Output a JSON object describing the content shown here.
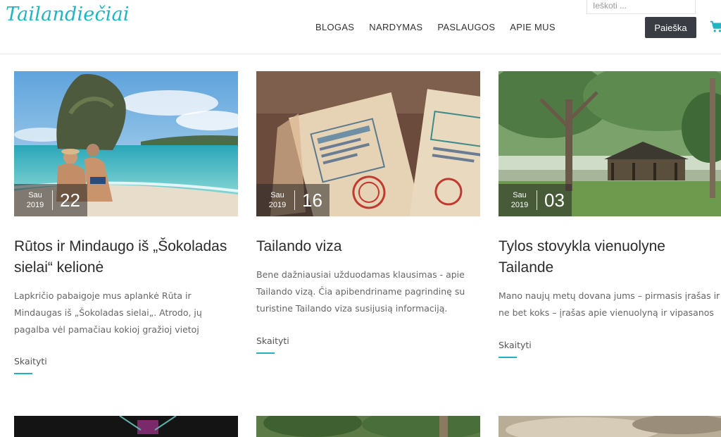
{
  "site": {
    "logo": "Tailandiečiai"
  },
  "nav": {
    "items": [
      "BLOGAS",
      "NARDYMAS",
      "PASLAUGOS",
      "APIE MUS"
    ]
  },
  "search": {
    "placeholder": "Ieškoti ...",
    "button_label": "Paieška"
  },
  "colors": {
    "accent": "#22b3c3",
    "search_button": "#3a3c44"
  },
  "posts": [
    {
      "month": "Sau",
      "year": "2019",
      "day": "22",
      "title": "Rūtos ir Mindaugo iš „Šokoladas sielai“ kelionė",
      "excerpt": "Lapkričio pabaigoje mus aplankė Rūta ir Mindaugas iš „Šokoladas sielai„. Atrodo, jų pagalba vėl pamačiau kokioj gražioj vietoj",
      "read_more": "Skaityti"
    },
    {
      "month": "Sau",
      "year": "2019",
      "day": "16",
      "title": "Tailando viza",
      "excerpt": "Bene dažniausiai užduodamas klausimas - apie Tailando vizą. Čia apibendriname pagrindinę su turistine Tailando viza susijusią informaciją.",
      "read_more": "Skaityti"
    },
    {
      "month": "Sau",
      "year": "2019",
      "day": "03",
      "title": "Tylos stovykla vienuolyne Tailande",
      "excerpt": "Mano naujų metų dovana jums – pirmasis įrašas ir ne bet koks – įrašas apie vienuolyną ir vipasanos",
      "read_more": "Skaityti"
    }
  ]
}
